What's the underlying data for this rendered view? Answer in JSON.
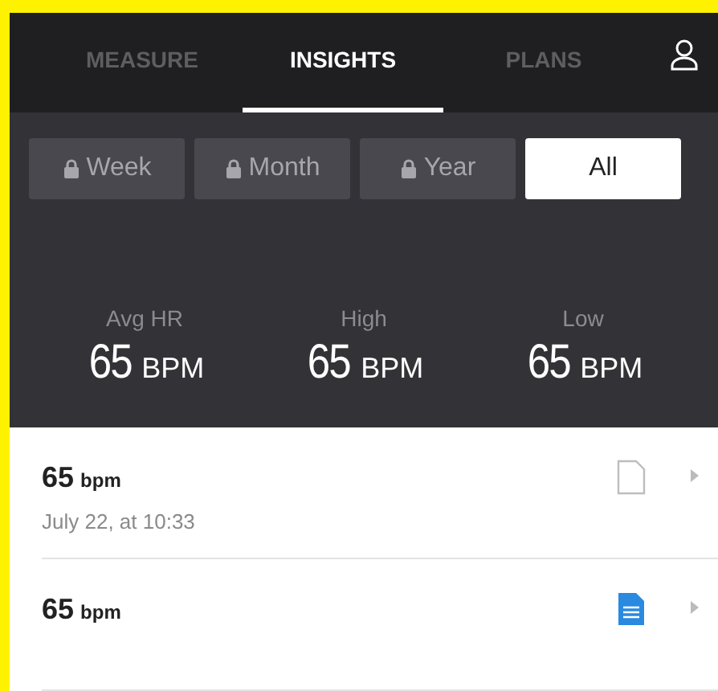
{
  "nav_tabs": [
    {
      "label": "MEASURE",
      "selected": false
    },
    {
      "label": "INSIGHTS",
      "selected": true
    },
    {
      "label": "PLANS",
      "selected": false
    }
  ],
  "periods": [
    {
      "label": "Week",
      "locked": true,
      "selected": false
    },
    {
      "label": "Month",
      "locked": true,
      "selected": false
    },
    {
      "label": "Year",
      "locked": true,
      "selected": false
    },
    {
      "label": "All",
      "locked": false,
      "selected": true
    }
  ],
  "stats": [
    {
      "label": "Avg HR",
      "value": "65",
      "unit": "BPM"
    },
    {
      "label": "High",
      "value": "65",
      "unit": "BPM"
    },
    {
      "label": "Low",
      "value": "65",
      "unit": "BPM"
    }
  ],
  "readings": [
    {
      "value": "65",
      "unit": "bpm",
      "time": "July 22, at 10:33",
      "has_note": false
    },
    {
      "value": "65",
      "unit": "bpm",
      "has_note": true
    }
  ]
}
